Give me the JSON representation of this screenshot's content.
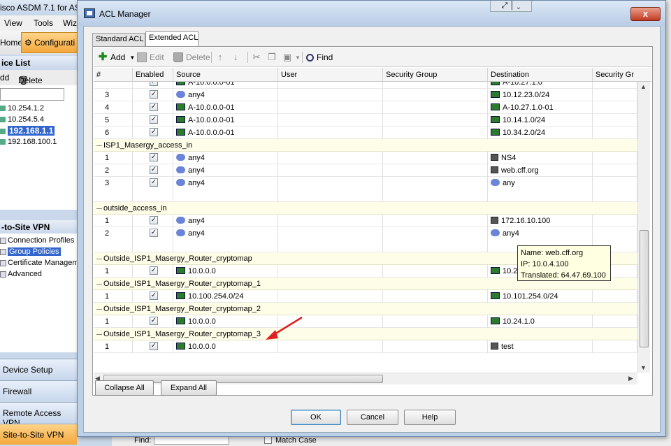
{
  "app": {
    "title": "isco ASDM 7.1 for AS",
    "menu": [
      "View",
      "Tools",
      "Wiz"
    ],
    "toolbar": {
      "home": "Home",
      "configuration": "Configurati"
    },
    "device_list": {
      "header": "ice List",
      "add": "dd",
      "delete": "Delete",
      "devices": [
        "10.254.1.2",
        "10.254.5.4",
        "192.168.1.1",
        "192.168.100.1"
      ],
      "selected": "192.168.1.1"
    },
    "vpn_panel": {
      "header": "-to-Site VPN",
      "items": [
        "Connection Profiles",
        "Group Policies",
        "Certificate Managem",
        "Advanced"
      ],
      "selected": "Group Policies"
    },
    "nav_buttons": [
      "Device Setup",
      "Firewall",
      "Remote Access VPN",
      "Site-to-Site VPN"
    ],
    "active_nav": "Site-to-Site VPN",
    "bottom_bar": {
      "find_label": "Find:",
      "match_case": "Match Case"
    }
  },
  "dialog": {
    "title": "ACL Manager",
    "close": "x",
    "tabs": [
      "Standard ACL",
      "Extended ACL"
    ],
    "active_tab": "Extended ACL",
    "toolbar": {
      "add": "Add",
      "edit": "Edit",
      "delete": "Delete",
      "find": "Find"
    },
    "columns": [
      "#",
      "Enabled",
      "Source",
      "User",
      "Security Group",
      "Destination",
      "Security Gr"
    ],
    "rows": [
      {
        "kind": "entry",
        "num": "",
        "source": "A-10.0.0.0-01",
        "src_icon": "net",
        "dest": "A-10.27.1.0",
        "dest_icon": "net",
        "partial": true
      },
      {
        "kind": "entry",
        "num": "3",
        "source": "any4",
        "src_icon": "cloud",
        "dest": "10.12.23.0/24",
        "dest_icon": "net"
      },
      {
        "kind": "entry",
        "num": "4",
        "source": "A-10.0.0.0-01",
        "src_icon": "net",
        "dest": "A-10.27.1.0-01",
        "dest_icon": "net"
      },
      {
        "kind": "entry",
        "num": "5",
        "source": "A-10.0.0.0-01",
        "src_icon": "net",
        "dest": "10.14.1.0/24",
        "dest_icon": "net"
      },
      {
        "kind": "entry",
        "num": "6",
        "source": "A-10.0.0.0-01",
        "src_icon": "net",
        "dest": "10.34.2.0/24",
        "dest_icon": "net"
      },
      {
        "kind": "group",
        "name": "ISP1_Masergy_access_in"
      },
      {
        "kind": "entry",
        "num": "1",
        "source": "any4",
        "src_icon": "cloud",
        "dest": "NS4",
        "dest_icon": "host"
      },
      {
        "kind": "entry",
        "num": "2",
        "source": "any4",
        "src_icon": "cloud",
        "dest": "web.cff.org",
        "dest_icon": "host"
      },
      {
        "kind": "entry",
        "num": "3",
        "source": "any4",
        "src_icon": "cloud",
        "dest": "any",
        "dest_icon": "cloud",
        "tall": true
      },
      {
        "kind": "group",
        "name": "outside_access_in"
      },
      {
        "kind": "entry",
        "num": "1",
        "source": "any4",
        "src_icon": "cloud",
        "dest": "172.16.10.100",
        "dest_icon": "host"
      },
      {
        "kind": "entry",
        "num": "2",
        "source": "any4",
        "src_icon": "cloud",
        "dest": "any4",
        "dest_icon": "cloud",
        "tall": true
      },
      {
        "kind": "group",
        "name": "Outside_ISP1_Masergy_Router_cryptomap"
      },
      {
        "kind": "entry",
        "num": "1",
        "source": "10.0.0.0",
        "src_icon": "net",
        "dest": "10.27.1.0/24",
        "dest_icon": "net"
      },
      {
        "kind": "group",
        "name": "Outside_ISP1_Masergy_Router_cryptomap_1"
      },
      {
        "kind": "entry",
        "num": "1",
        "source": "10.100.254.0/24",
        "src_icon": "net",
        "dest": "10.101.254.0/24",
        "dest_icon": "net"
      },
      {
        "kind": "group",
        "name": "Outside_ISP1_Masergy_Router_cryptomap_2"
      },
      {
        "kind": "entry",
        "num": "1",
        "source": "10.0.0.0",
        "src_icon": "net",
        "dest": "10.24.1.0",
        "dest_icon": "net"
      },
      {
        "kind": "group",
        "name": "Outside_ISP1_Masergy_Router_cryptomap_3"
      },
      {
        "kind": "entry",
        "num": "1",
        "source": "10.0.0.0",
        "src_icon": "net",
        "dest": "test",
        "dest_icon": "host"
      }
    ],
    "tooltip": {
      "name": "Name: web.cff.org",
      "ip": "IP: 10.0.4.100",
      "translated": "Translated: 64.47.69.100"
    },
    "collapse_all": "Collapse All",
    "expand_all": "Expand All",
    "ok": "OK",
    "cancel": "Cancel",
    "help": "Help",
    "annotation_color": "#e02020"
  }
}
